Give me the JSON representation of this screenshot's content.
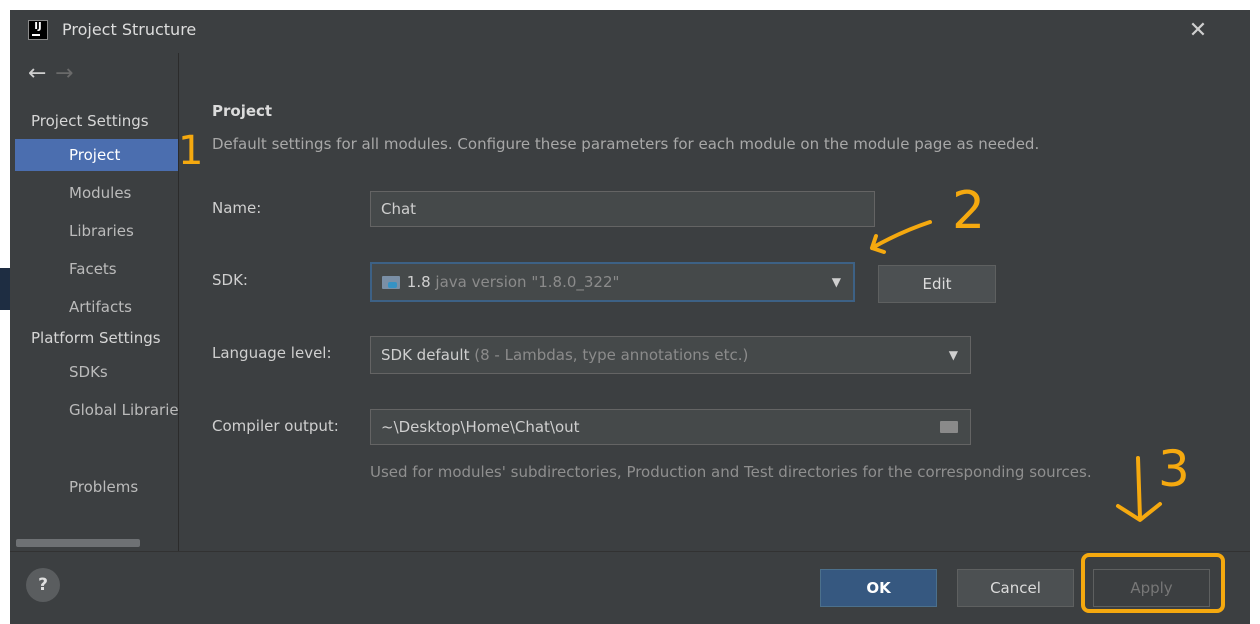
{
  "window": {
    "title": "Project Structure",
    "logo_text": "IJ",
    "close_symbol": "✕"
  },
  "nav": {
    "back": "←",
    "forward": "→"
  },
  "sidebar": {
    "project_settings_header": "Project Settings",
    "platform_settings_header": "Platform Settings",
    "items": [
      {
        "label": "Project",
        "selected": true
      },
      {
        "label": "Modules"
      },
      {
        "label": "Libraries"
      },
      {
        "label": "Facets"
      },
      {
        "label": "Artifacts"
      },
      {
        "label": "SDKs"
      },
      {
        "label": "Global Libraries"
      },
      {
        "label": "Problems"
      }
    ]
  },
  "project": {
    "title": "Project",
    "description": "Default settings for all modules. Configure these parameters for each module on the module page as needed.",
    "name_label": "Name:",
    "name_value": "Chat",
    "sdk_label": "SDK:",
    "sdk_value": "1.8",
    "sdk_detail": "java version \"1.8.0_322\"",
    "edit_button": "Edit",
    "language_label": "Language level:",
    "language_value": "SDK default",
    "language_detail": "(8 - Lambdas, type annotations etc.)",
    "compiler_label": "Compiler output:",
    "compiler_value": "~\\Desktop\\Home\\Chat\\out",
    "compiler_hint": "Used for modules' subdirectories, Production and Test directories for the corresponding sources."
  },
  "footer": {
    "help": "?",
    "ok": "OK",
    "cancel": "Cancel",
    "apply": "Apply"
  },
  "annotations": {
    "one": "1",
    "two": "2",
    "three": "3"
  },
  "colors": {
    "background": "#3c3f41",
    "selection": "#4b6eaf",
    "ok_button": "#365880",
    "annotation": "#f5a90f"
  }
}
